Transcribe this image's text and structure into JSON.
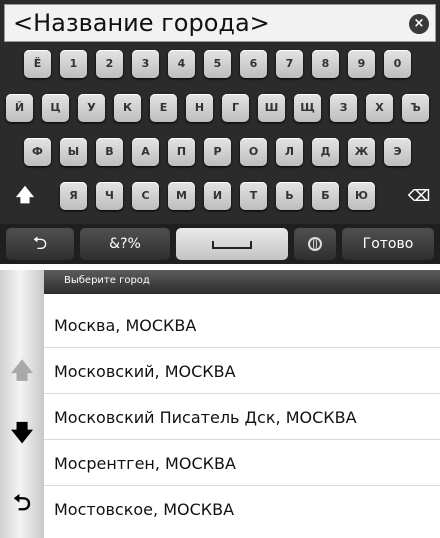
{
  "keyboard": {
    "search_text": "<Название города>",
    "clear_icon": "×",
    "row1": [
      "Ё",
      "1",
      "2",
      "3",
      "4",
      "5",
      "6",
      "7",
      "8",
      "9",
      "0"
    ],
    "row2": [
      "Й",
      "Ц",
      "У",
      "К",
      "Е",
      "Н",
      "Г",
      "Ш",
      "Щ",
      "З",
      "Х",
      "Ъ"
    ],
    "row3": [
      "Ф",
      "Ы",
      "В",
      "А",
      "П",
      "Р",
      "О",
      "Л",
      "Д",
      "Ж",
      "Э"
    ],
    "row4_letters": [
      "Я",
      "Ч",
      "С",
      "М",
      "И",
      "Т",
      "Ь",
      "Б",
      "Ю"
    ],
    "shift_icon": "🡅",
    "backspace_icon": "⌫",
    "back_icon": "⮌",
    "symbols_label": "&?%",
    "done_label": "Готово"
  },
  "city_list": {
    "header": "Выберите город",
    "items": [
      "Москва, МОСКВА",
      "Московский, МОСКВА",
      "Московский Писатель Дск, МОСКВА",
      "Мосрентген, МОСКВА",
      "Мостовское, МОСКВА"
    ],
    "scroll_up_icon": "🡅",
    "scroll_down_icon": "🡇",
    "back_icon": "⮌",
    "colors": {
      "up_arrow": "#a9a9a9",
      "down_arrow": "#000000"
    }
  }
}
